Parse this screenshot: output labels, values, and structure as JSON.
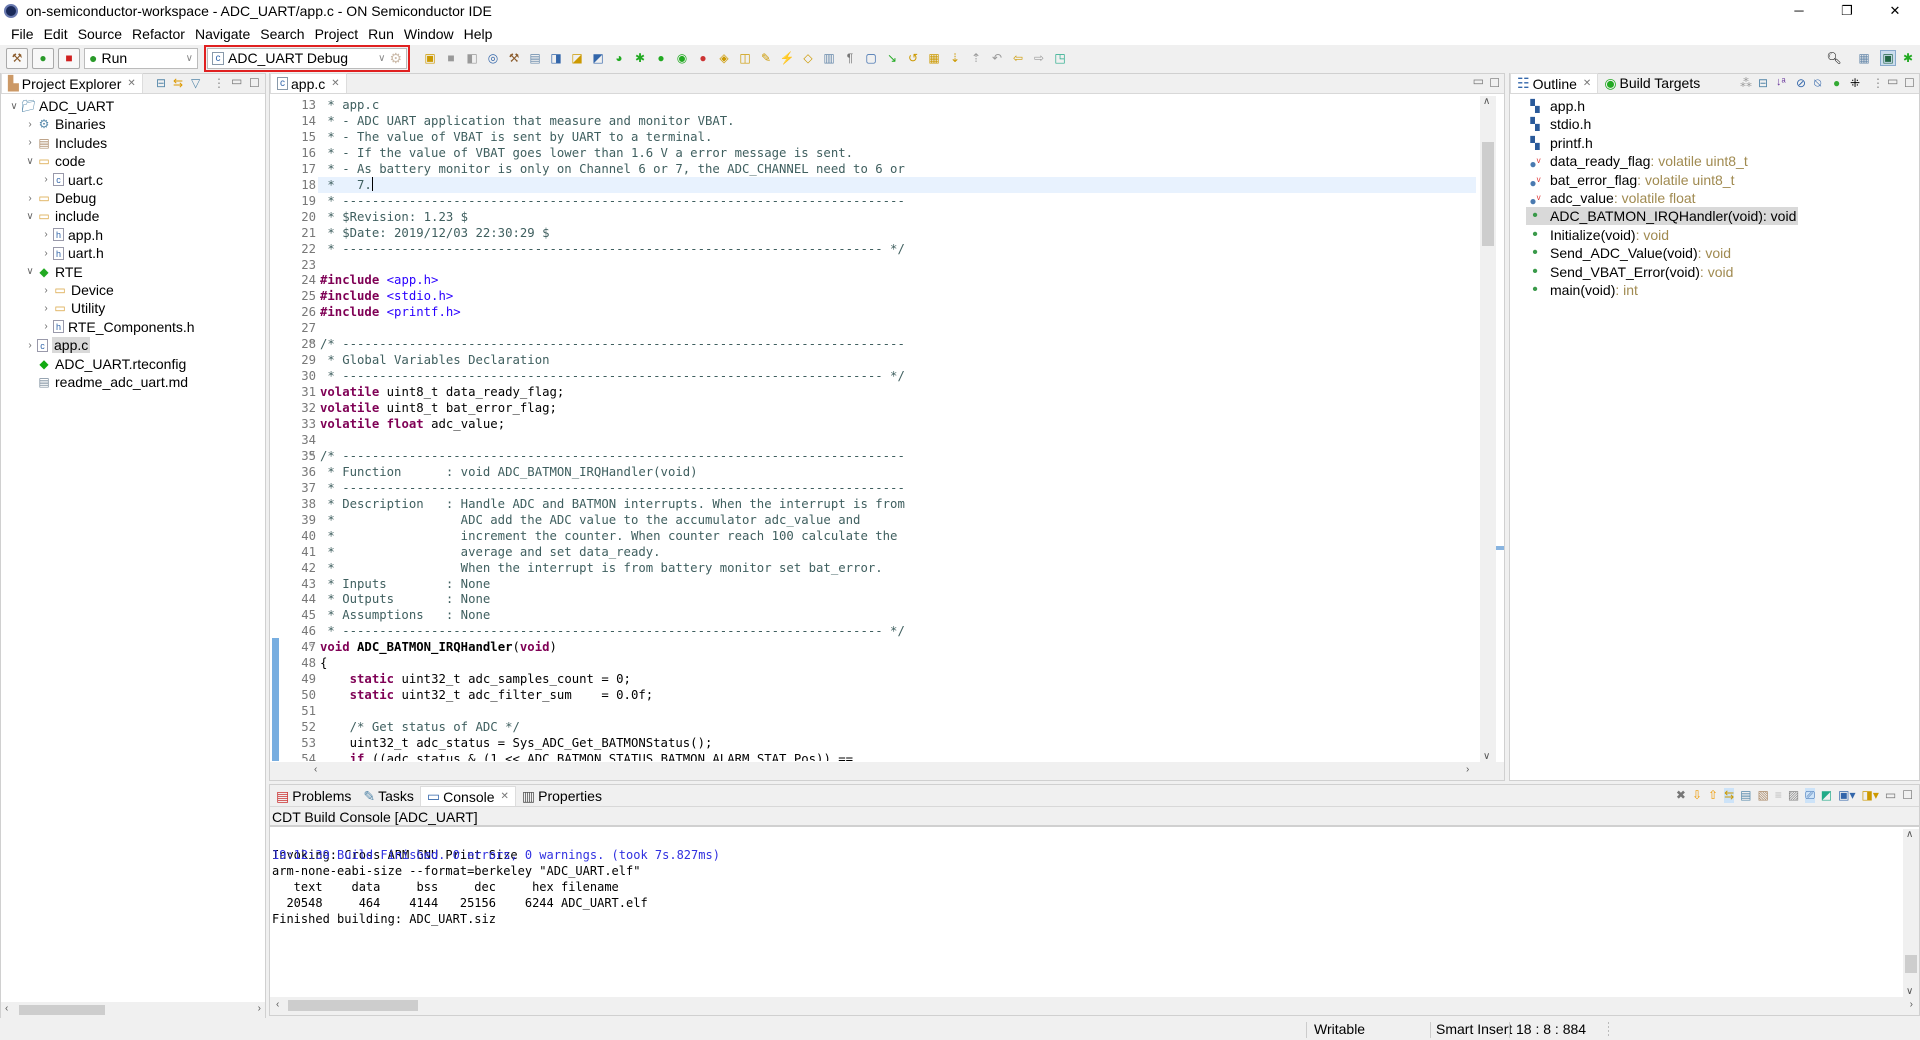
{
  "window": {
    "title": "on-semiconductor-workspace - ADC_UART/app.c - ON Semiconductor IDE",
    "minimize": "─",
    "restore": "❐",
    "close": "✕"
  },
  "menu": [
    "File",
    "Edit",
    "Source",
    "Refactor",
    "Navigate",
    "Search",
    "Project",
    "Run",
    "Window",
    "Help"
  ],
  "toolbar": {
    "run_mode": "Run",
    "launch_config": "ADC_UART Debug",
    "accent": "#e02020",
    "icons": [
      "new-icon",
      "save-icon",
      "save-all-icon",
      "target-icon",
      "build-icon",
      "print-size-icon",
      "new-c-project-icon",
      "new-source-folder-icon",
      "new-c-file-icon",
      "new-class-icon",
      "debug-icon",
      "run-icon",
      "coverage-icon",
      "external-tools-icon",
      "open-type-icon",
      "open-folder-icon",
      "search-icon",
      "toggle-mark-occurrences-icon",
      "highlight-icon",
      "block-selection-icon",
      "show-whitespace-icon",
      "terminal-icon",
      "pin-icon",
      "back-history-icon",
      "package-icon",
      "next-annotation-icon",
      "prev-annotation-icon",
      "last-edit-icon",
      "back-icon",
      "forward-icon",
      "open-perspective-icon"
    ]
  },
  "project_explorer": {
    "title": "Project Explorer",
    "items": [
      {
        "label": "ADC_UART",
        "level": 0,
        "twisty": "open",
        "icon": "project"
      },
      {
        "label": "Binaries",
        "level": 1,
        "twisty": "closed",
        "icon": "binaries"
      },
      {
        "label": "Includes",
        "level": 1,
        "twisty": "closed",
        "icon": "includes"
      },
      {
        "label": "code",
        "level": 1,
        "twisty": "open",
        "icon": "folder"
      },
      {
        "label": "uart.c",
        "level": 2,
        "twisty": "closed",
        "icon": "c-file"
      },
      {
        "label": "Debug",
        "level": 1,
        "twisty": "closed",
        "icon": "folder"
      },
      {
        "label": "include",
        "level": 1,
        "twisty": "open",
        "icon": "folder"
      },
      {
        "label": "app.h",
        "level": 2,
        "twisty": "closed",
        "icon": "h-file"
      },
      {
        "label": "uart.h",
        "level": 2,
        "twisty": "closed",
        "icon": "h-file"
      },
      {
        "label": "RTE",
        "level": 1,
        "twisty": "open",
        "icon": "rte-folder"
      },
      {
        "label": "Device",
        "level": 2,
        "twisty": "closed",
        "icon": "folder"
      },
      {
        "label": "Utility",
        "level": 2,
        "twisty": "closed",
        "icon": "folder"
      },
      {
        "label": "RTE_Components.h",
        "level": 2,
        "twisty": "closed",
        "icon": "h-file"
      },
      {
        "label": "app.c",
        "level": 1,
        "twisty": "closed",
        "icon": "c-file",
        "selected": true
      },
      {
        "label": "ADC_UART.rteconfig",
        "level": 1,
        "twisty": "none",
        "icon": "rteconfig"
      },
      {
        "label": "readme_adc_uart.md",
        "level": 1,
        "twisty": "none",
        "icon": "md-file"
      }
    ]
  },
  "editor": {
    "tab": "app.c",
    "lines": [
      {
        "n": 13,
        "s": [
          [
            "c",
            " * app.c"
          ]
        ]
      },
      {
        "n": 14,
        "s": [
          [
            "c",
            " * - ADC UART application that measure and monitor VBAT."
          ]
        ]
      },
      {
        "n": 15,
        "s": [
          [
            "c",
            " * - The value of VBAT is sent by UART to a terminal."
          ]
        ]
      },
      {
        "n": 16,
        "s": [
          [
            "c",
            " * - If the value of VBAT goes lower than 1.6 V a error message is sent."
          ]
        ]
      },
      {
        "n": 17,
        "s": [
          [
            "c",
            " * - As battery monitor is only on Channel 6 or 7, the ADC_CHANNEL need to 6 or"
          ]
        ]
      },
      {
        "n": 18,
        "s": [
          [
            "c",
            " *   7."
          ]
        ],
        "current": true
      },
      {
        "n": 19,
        "s": [
          [
            "c",
            " * ----------------------------------------------------------------------------"
          ]
        ]
      },
      {
        "n": 20,
        "s": [
          [
            "c",
            " * $Revision: 1.23 $"
          ]
        ]
      },
      {
        "n": 21,
        "s": [
          [
            "c",
            " * $Date: 2019/12/03 22:30:29 $"
          ]
        ]
      },
      {
        "n": 22,
        "s": [
          [
            "c",
            " * ------------------------------------------------------------------------- */"
          ]
        ]
      },
      {
        "n": 23,
        "s": []
      },
      {
        "n": 24,
        "s": [
          [
            "k",
            "#include"
          ],
          [
            "p",
            " "
          ],
          [
            "s",
            "<app.h>"
          ]
        ]
      },
      {
        "n": 25,
        "s": [
          [
            "k",
            "#include"
          ],
          [
            "p",
            " "
          ],
          [
            "s",
            "<stdio.h>"
          ]
        ]
      },
      {
        "n": 26,
        "s": [
          [
            "k",
            "#include"
          ],
          [
            "p",
            " "
          ],
          [
            "s",
            "<printf.h>"
          ]
        ]
      },
      {
        "n": 27,
        "s": []
      },
      {
        "n": 28,
        "s": [
          [
            "c",
            "/* ----------------------------------------------------------------------------"
          ]
        ],
        "fold": true
      },
      {
        "n": 29,
        "s": [
          [
            "c",
            " * Global Variables Declaration"
          ]
        ]
      },
      {
        "n": 30,
        "s": [
          [
            "c",
            " * ------------------------------------------------------------------------- */"
          ]
        ]
      },
      {
        "n": 31,
        "s": [
          [
            "k",
            "volatile"
          ],
          [
            "p",
            " uint8_t data_ready_flag;"
          ]
        ]
      },
      {
        "n": 32,
        "s": [
          [
            "k",
            "volatile"
          ],
          [
            "p",
            " uint8_t bat_error_flag;"
          ]
        ]
      },
      {
        "n": 33,
        "s": [
          [
            "k",
            "volatile"
          ],
          [
            "p",
            " "
          ],
          [
            "k",
            "float"
          ],
          [
            "p",
            " adc_value;"
          ]
        ]
      },
      {
        "n": 34,
        "s": []
      },
      {
        "n": 35,
        "s": [
          [
            "c",
            "/* ----------------------------------------------------------------------------"
          ]
        ],
        "fold": true
      },
      {
        "n": 36,
        "s": [
          [
            "c",
            " * Function      : void ADC_BATMON_IRQHandler(void)"
          ]
        ]
      },
      {
        "n": 37,
        "s": [
          [
            "c",
            " * ----------------------------------------------------------------------------"
          ]
        ]
      },
      {
        "n": 38,
        "s": [
          [
            "c",
            " * Description   : Handle ADC and BATMON interrupts. When the interrupt is from"
          ]
        ]
      },
      {
        "n": 39,
        "s": [
          [
            "c",
            " *                 ADC add the ADC value to the accumulator adc_value and"
          ]
        ]
      },
      {
        "n": 40,
        "s": [
          [
            "c",
            " *                 increment the counter. When counter reach 100 calculate the"
          ]
        ]
      },
      {
        "n": 41,
        "s": [
          [
            "c",
            " *                 average and set data_ready."
          ]
        ]
      },
      {
        "n": 42,
        "s": [
          [
            "c",
            " *                 When the interrupt is from battery monitor set bat_error."
          ]
        ]
      },
      {
        "n": 43,
        "s": [
          [
            "c",
            " * Inputs        : None"
          ]
        ]
      },
      {
        "n": 44,
        "s": [
          [
            "c",
            " * Outputs       : None"
          ]
        ]
      },
      {
        "n": 45,
        "s": [
          [
            "c",
            " * Assumptions   : None"
          ]
        ]
      },
      {
        "n": 46,
        "s": [
          [
            "c",
            " * ------------------------------------------------------------------------- */"
          ]
        ]
      },
      {
        "n": 47,
        "s": [
          [
            "k",
            "void"
          ],
          [
            "fn",
            " ADC_BATMON_IRQHandler"
          ],
          [
            "p",
            "("
          ],
          [
            "k",
            "void"
          ],
          [
            "p",
            ")"
          ]
        ],
        "fold": true
      },
      {
        "n": 48,
        "s": [
          [
            "p",
            "{"
          ]
        ]
      },
      {
        "n": 49,
        "s": [
          [
            "p",
            "    "
          ],
          [
            "k",
            "static"
          ],
          [
            "p",
            " uint32_t adc_samples_count = 0;"
          ]
        ]
      },
      {
        "n": 50,
        "s": [
          [
            "p",
            "    "
          ],
          [
            "k",
            "static"
          ],
          [
            "p",
            " uint32_t adc_filter_sum    = 0.0f;"
          ]
        ]
      },
      {
        "n": 51,
        "s": []
      },
      {
        "n": 52,
        "s": [
          [
            "p",
            "    "
          ],
          [
            "c",
            "/* Get status of ADC */"
          ]
        ]
      },
      {
        "n": 53,
        "s": [
          [
            "p",
            "    uint32_t adc_status = Sys_ADC_Get_BATMONStatus();"
          ]
        ]
      },
      {
        "n": 54,
        "s": [
          [
            "p",
            "    "
          ],
          [
            "k",
            "if"
          ],
          [
            "p",
            " ((adc_status & (1 << ADC_BATMON_STATUS_BATMON_ALARM_STAT_Pos)) =="
          ]
        ]
      }
    ]
  },
  "outline": {
    "tabs": [
      "Outline",
      "Build Targets"
    ],
    "items": [
      {
        "name": "app.h",
        "type": "",
        "kind": "include"
      },
      {
        "name": "stdio.h",
        "type": "",
        "kind": "include"
      },
      {
        "name": "printf.h",
        "type": "",
        "kind": "include"
      },
      {
        "name": "data_ready_flag",
        "type": " : volatile uint8_t",
        "kind": "variable"
      },
      {
        "name": "bat_error_flag",
        "type": " : volatile uint8_t",
        "kind": "variable"
      },
      {
        "name": "adc_value",
        "type": " : volatile float",
        "kind": "variable"
      },
      {
        "name": "ADC_BATMON_IRQHandler(void)",
        "type": " : void",
        "kind": "function",
        "selected": true
      },
      {
        "name": "Initialize(void)",
        "type": " : void",
        "kind": "function"
      },
      {
        "name": "Send_ADC_Value(void)",
        "type": " : void",
        "kind": "function"
      },
      {
        "name": "Send_VBAT_Error(void)",
        "type": " : void",
        "kind": "function"
      },
      {
        "name": "main(void)",
        "type": " : int",
        "kind": "function"
      }
    ]
  },
  "bottom": {
    "tabs": [
      "Problems",
      "Tasks",
      "Console",
      "Properties"
    ],
    "active_tab": "Console",
    "console_title": "CDT Build Console [ADC_UART]",
    "console_lines": [
      "",
      "Invoking: Cross ARM GNU Print Size",
      "arm-none-eabi-size --format=berkeley \"ADC_UART.elf\"",
      "   text    data     bss     dec     hex filename",
      "  20548     464    4144   25156    6244 ADC_UART.elf",
      "Finished building: ADC_UART.siz",
      "",
      ""
    ],
    "build_finished": "19:12:39 Build Finished. 0 errors, 0 warnings. (took 7s.827ms)",
    "build_color": "#3030e0"
  },
  "status": {
    "writable": "Writable",
    "insert_mode": "Smart Insert",
    "position": "18 : 8 : 884"
  }
}
